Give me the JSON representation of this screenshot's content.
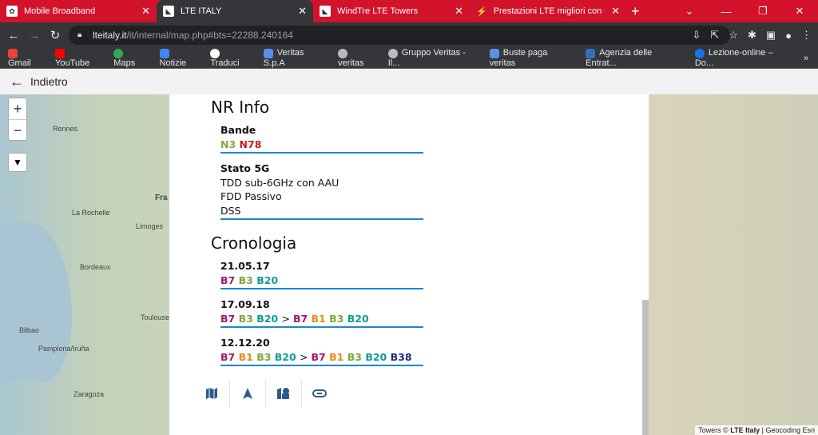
{
  "tabs": [
    {
      "title": "Mobile Broadband"
    },
    {
      "title": "LTE ITALY"
    },
    {
      "title": "WindTre LTE Towers"
    },
    {
      "title": "Prestazioni LTE migliori con cavo"
    }
  ],
  "url": {
    "host": "lteitaly.it",
    "path": "/it/internal/map.php#bts=22288.240164"
  },
  "bookmarks": [
    "Gmail",
    "YouTube",
    "Maps",
    "Notizie",
    "Traduci",
    "Veritas S.p.A",
    "veritas",
    "Gruppo Veritas - Il...",
    "Buste paga veritas",
    "Agenzia delle Entrat...",
    "Lezione-online – Do..."
  ],
  "appbar": {
    "back": "Indietro"
  },
  "map": {
    "labels": [
      "Rennes",
      "Fra",
      "La Rochelle",
      "Limoges",
      "Bordeaux",
      "Toulouse",
      "Bilbao",
      "Pamplona/Iruña",
      "Zaragoza"
    ],
    "attribution_pre": "Towers © ",
    "attribution_brand": "LTE Italy",
    "attribution_post": " | Geocoding Esri"
  },
  "nr": {
    "heading": "NR Info",
    "bande_label": "Bande",
    "bande": [
      "N3",
      "N78"
    ],
    "stato_label": "Stato 5G",
    "stato": [
      "TDD sub-6GHz con AAU",
      "FDD Passivo",
      "DSS"
    ]
  },
  "cron": {
    "heading": "Cronologia",
    "entries": [
      {
        "date": "21.05.17",
        "before": [
          "B7",
          "B3",
          "B20"
        ]
      },
      {
        "date": "17.09.18",
        "before": [
          "B7",
          "B3",
          "B20"
        ],
        "after": [
          "B7",
          "B1",
          "B3",
          "B20"
        ]
      },
      {
        "date": "12.12.20",
        "before": [
          "B7",
          "B1",
          "B3",
          "B20"
        ],
        "after": [
          "B7",
          "B1",
          "B3",
          "B20",
          "B38"
        ]
      }
    ]
  },
  "colors": {
    "B7": "#a0196e",
    "B3": "#7fa73c",
    "B20": "#139a9a",
    "B1": "#e38d16",
    "B38": "#1e2b78",
    "N3": "#7fa73c",
    "N78": "#c81d1d"
  }
}
